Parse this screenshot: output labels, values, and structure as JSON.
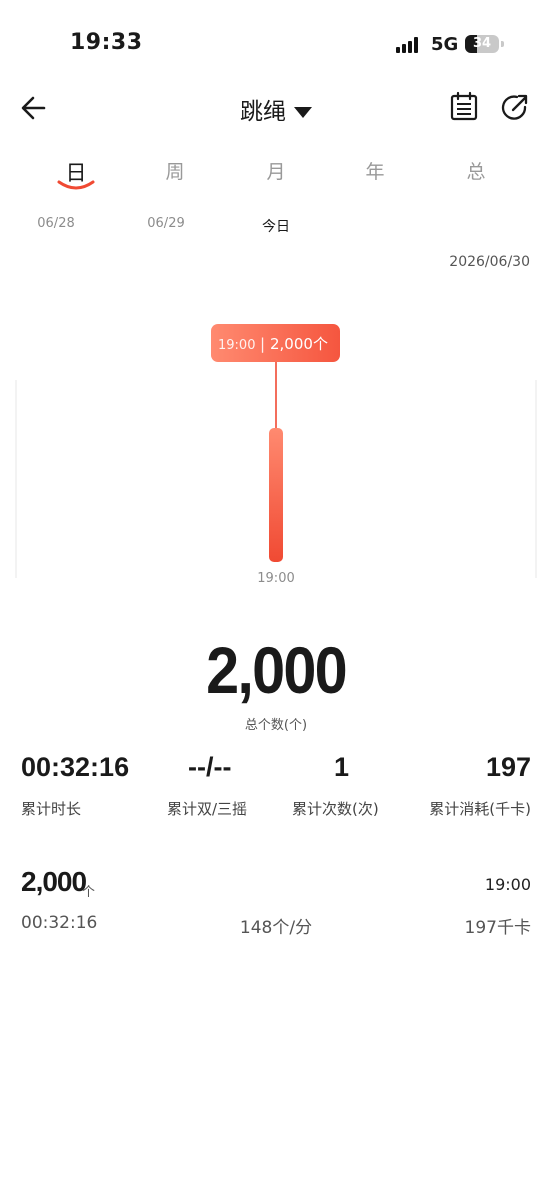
{
  "status": {
    "time": "19:33",
    "network": "5G",
    "battery": "34",
    "battery_level": 0.34
  },
  "header": {
    "title": "跳绳",
    "icons": [
      "back-arrow-icon",
      "caret-down-icon",
      "calendar-list-icon",
      "share-icon"
    ]
  },
  "tabs": [
    {
      "label": "日",
      "active": true
    },
    {
      "label": "周",
      "active": false
    },
    {
      "label": "月",
      "active": false
    },
    {
      "label": "年",
      "active": false
    },
    {
      "label": "总",
      "active": false
    }
  ],
  "dates": [
    {
      "label": "06/28",
      "active": false
    },
    {
      "label": "06/29",
      "active": false
    },
    {
      "label": "今日",
      "active": true
    }
  ],
  "full_date": "2026/06/30",
  "chart_data": {
    "type": "bar",
    "categories": [
      "19:00"
    ],
    "values": [
      2000
    ],
    "tooltip": {
      "time": "19:00",
      "value": "2,000个"
    },
    "xlabel": "",
    "ylabel": "",
    "colors": {
      "top": "#ff8a70",
      "bottom": "#f04a33"
    }
  },
  "summary": {
    "total": "2,000",
    "total_label": "总个数(个)",
    "stats": [
      {
        "value": "00:32:16",
        "label": "累计时长"
      },
      {
        "value": "--/--",
        "label": "累计双/三摇"
      },
      {
        "value": "1",
        "label": "累计次数(次)"
      },
      {
        "value": "197",
        "label": "累计消耗(千卡)"
      }
    ]
  },
  "record": {
    "count": "2,000",
    "unit": "个",
    "time": "19:00",
    "duration": "00:32:16",
    "pace": "148个/分",
    "calories": "197千卡"
  },
  "colors": {
    "accent": "#f04a33",
    "accent_light": "#ff8a70"
  }
}
